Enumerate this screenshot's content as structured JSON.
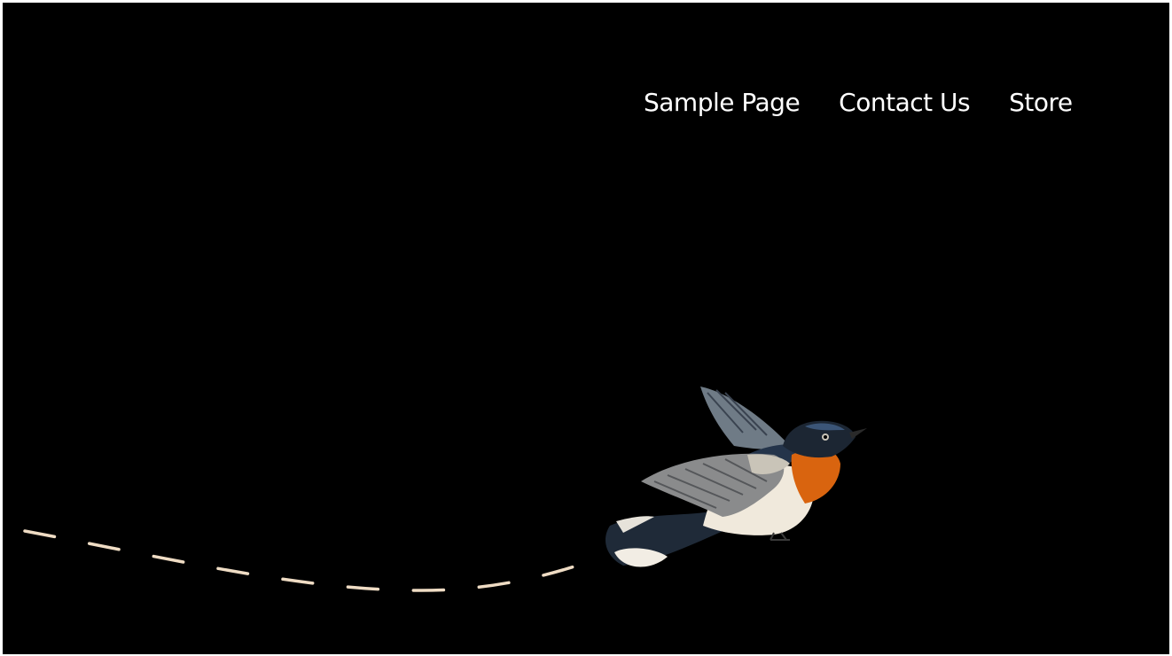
{
  "nav": {
    "items": [
      {
        "label": "Sample Page"
      },
      {
        "label": "Contact Us"
      },
      {
        "label": "Store"
      }
    ]
  },
  "colors": {
    "background": "#000000",
    "nav_text": "#ffffff",
    "flight_path": "#efdcc4",
    "bird_throat": "#d9640f",
    "bird_head": "#1c2633",
    "bird_wing": "#8a8b8c",
    "bird_belly": "#f0e9dc"
  },
  "illustration": {
    "subject": "bird-icon",
    "trail": "dashed-flight-path"
  }
}
